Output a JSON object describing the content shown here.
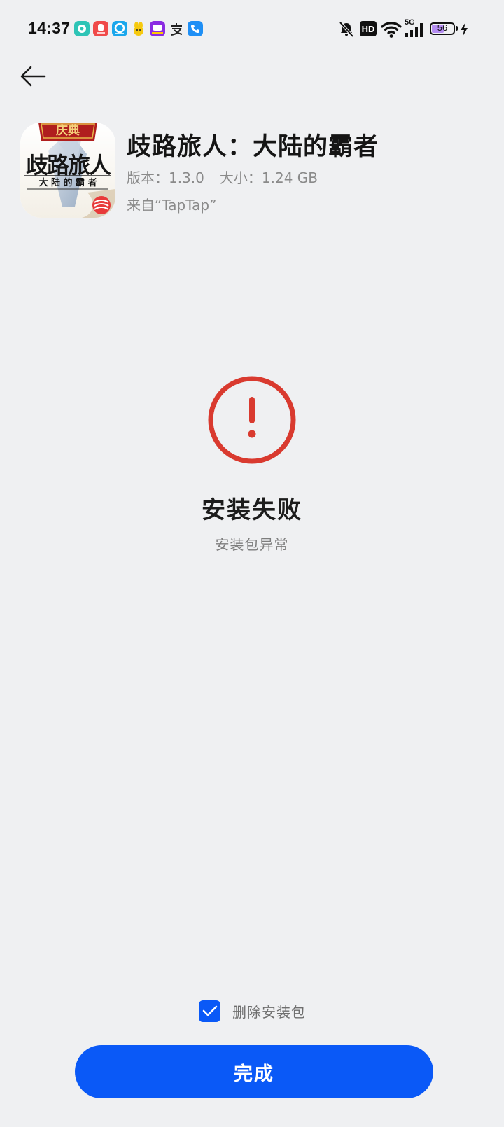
{
  "status_bar": {
    "time": "14:37",
    "network_type": "5G",
    "hd_badge": "HD",
    "battery_level": "56",
    "notification_icons": [
      "chat-app-icon",
      "red-app-icon",
      "browser-app-icon",
      "yellow-app-icon",
      "purple-app-icon",
      "alipay-icon",
      "phone-icon"
    ],
    "right_icons": [
      "bell-muted-icon",
      "hd-icon",
      "wifi-icon",
      "signal-icon",
      "battery-icon",
      "charging-icon"
    ]
  },
  "header": {
    "back_icon": "arrow-left-icon"
  },
  "app": {
    "name": "歧路旅人：大陆的霸者",
    "version_text": "版本：1.3.0",
    "size_text": "大小：1.24 GB",
    "source_text": "来自“TapTap”",
    "icon_banner": "庆典",
    "icon_title": "歧路旅人",
    "icon_subtitle": "大 陆 的 霸 者"
  },
  "result": {
    "icon": "exclamation-circle-icon",
    "status_color": "#d93a2f",
    "title": "安装失败",
    "detail": "安装包异常"
  },
  "options": {
    "delete_package_label": "删除安装包",
    "delete_package_checked": true
  },
  "actions": {
    "done_label": "完成"
  },
  "colors": {
    "accent": "#0a59f7",
    "background": "#eff0f2"
  }
}
